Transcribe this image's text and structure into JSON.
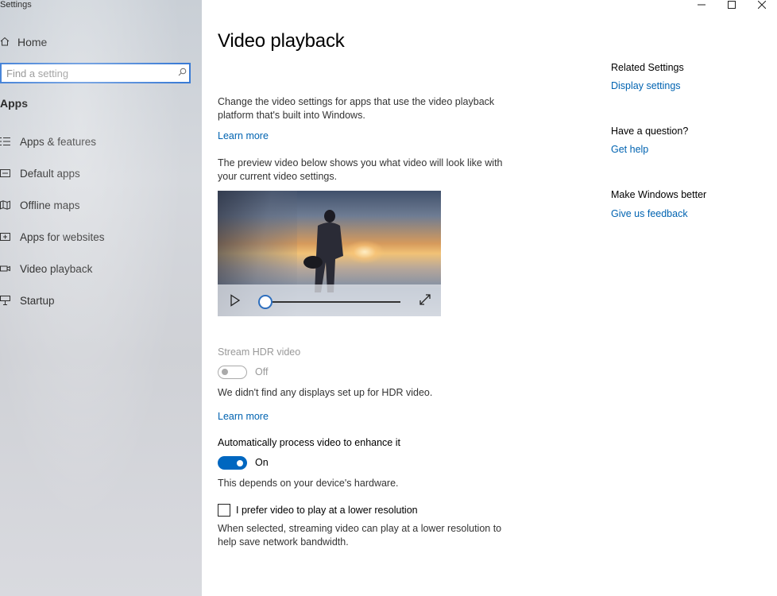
{
  "window": {
    "title": "Settings",
    "minimize_icon": "minimize-icon",
    "maximize_icon": "maximize-icon",
    "close_icon": "close-icon"
  },
  "sidebar": {
    "home_label": "Home",
    "search_placeholder": "Find a setting",
    "section_label": "Apps",
    "items": [
      {
        "label": "Apps & features",
        "icon": "apps-features-icon"
      },
      {
        "label": "Default apps",
        "icon": "default-apps-icon"
      },
      {
        "label": "Offline maps",
        "icon": "offline-maps-icon"
      },
      {
        "label": "Apps for websites",
        "icon": "apps-websites-icon"
      },
      {
        "label": "Video playback",
        "icon": "video-playback-icon"
      },
      {
        "label": "Startup",
        "icon": "startup-icon"
      }
    ]
  },
  "main": {
    "title": "Video playback",
    "intro": "Change the video settings for apps that use the video playback platform that's built into Windows.",
    "learn_more_1": "Learn more",
    "preview_text": "The preview video below shows you what video will look like with your current video settings.",
    "video_progress": 0.05,
    "hdr": {
      "label": "Stream HDR video",
      "state": "Off",
      "note": "We didn't find any displays set up for HDR video.",
      "learn_more": "Learn more"
    },
    "enhance": {
      "label": "Automatically process video to enhance it",
      "state": "On",
      "note": "This depends on your device's hardware."
    },
    "lower_res": {
      "label": "I prefer video to play at a lower resolution",
      "checked": false,
      "note": "When selected, streaming video can play at a lower resolution to help save network bandwidth."
    }
  },
  "related": {
    "related_head": "Related Settings",
    "display_link": "Display settings",
    "question_head": "Have a question?",
    "help_link": "Get help",
    "feedback_head": "Make Windows better",
    "feedback_link": "Give us feedback"
  },
  "colors": {
    "accent": "#0067c0",
    "link": "#0063b1"
  }
}
